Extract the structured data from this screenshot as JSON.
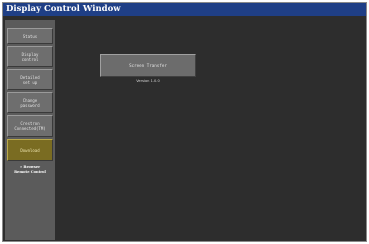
{
  "window": {
    "title": "Display Control Window"
  },
  "sidebar": {
    "items": [
      {
        "label": "Status"
      },
      {
        "label": "Display\ncontrol"
      },
      {
        "label": "Detailed\nset up"
      },
      {
        "label": "Change\npassword"
      },
      {
        "label": "Crestron\nConnected(TM)"
      },
      {
        "label": "Download"
      }
    ],
    "browser_link": "» Browser\nRemote Control"
  },
  "main": {
    "screen_transfer_label": "Screen Transfer",
    "version": "Version 1.0.0"
  },
  "colors": {
    "titlebar": "#1f3f86",
    "background": "#2d2d2d",
    "sidebar": "#5b5b5b",
    "button": "#6e6e6e",
    "active_button": "#7a6c22"
  }
}
